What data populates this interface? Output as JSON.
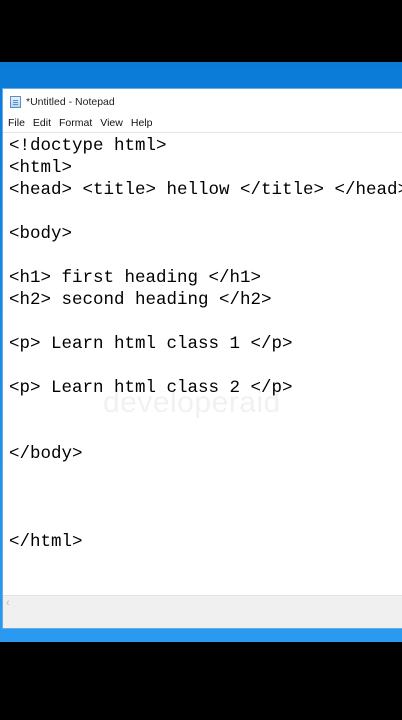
{
  "window": {
    "title": "*Untitled - Notepad",
    "icon": "notepad-icon"
  },
  "menu": {
    "items": [
      "File",
      "Edit",
      "Format",
      "View",
      "Help"
    ]
  },
  "editor": {
    "content": "<!doctype html>\n<html>\n<head> <title> hellow </title> </head>\n\n<body>\n\n<h1> first heading </h1>\n<h2> second heading </h2>\n\n<p> Learn html class 1 </p>\n\n<p> Learn html class 2 </p>\n\n\n</body>\n\n\n\n</html>"
  },
  "watermark": "developeraid",
  "colors": {
    "desktop": "#1e8fe8",
    "window_bg": "#ffffff"
  }
}
